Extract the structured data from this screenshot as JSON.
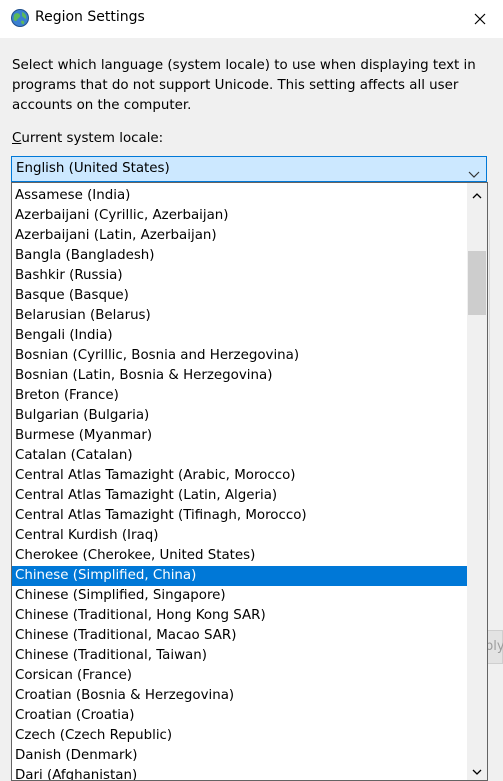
{
  "window": {
    "title": "Region Settings"
  },
  "dialog": {
    "description": "Select which language (system locale) to use when displaying text in programs that do not support Unicode. This setting affects all user accounts on the computer.",
    "locale_label_mnemonic": "C",
    "locale_label_rest": "urrent system locale:",
    "selected_locale": "English (United States)",
    "background_button_fragment": "ply"
  },
  "locales": [
    {
      "label": "Assamese (India)"
    },
    {
      "label": "Azerbaijani (Cyrillic, Azerbaijan)"
    },
    {
      "label": "Azerbaijani (Latin, Azerbaijan)"
    },
    {
      "label": "Bangla (Bangladesh)"
    },
    {
      "label": "Bashkir (Russia)"
    },
    {
      "label": "Basque (Basque)"
    },
    {
      "label": "Belarusian (Belarus)"
    },
    {
      "label": "Bengali (India)"
    },
    {
      "label": "Bosnian (Cyrillic, Bosnia and Herzegovina)"
    },
    {
      "label": "Bosnian (Latin, Bosnia & Herzegovina)"
    },
    {
      "label": "Breton (France)"
    },
    {
      "label": "Bulgarian (Bulgaria)"
    },
    {
      "label": "Burmese (Myanmar)"
    },
    {
      "label": "Catalan (Catalan)"
    },
    {
      "label": "Central Atlas Tamazight (Arabic, Morocco)"
    },
    {
      "label": "Central Atlas Tamazight (Latin, Algeria)"
    },
    {
      "label": "Central Atlas Tamazight (Tifinagh, Morocco)"
    },
    {
      "label": "Central Kurdish (Iraq)"
    },
    {
      "label": "Cherokee (Cherokee, United States)"
    },
    {
      "label": "Chinese (Simplified, China)",
      "selected": true
    },
    {
      "label": "Chinese (Simplified, Singapore)"
    },
    {
      "label": "Chinese (Traditional, Hong Kong SAR)"
    },
    {
      "label": "Chinese (Traditional, Macao SAR)"
    },
    {
      "label": "Chinese (Traditional, Taiwan)"
    },
    {
      "label": "Corsican (France)"
    },
    {
      "label": "Croatian (Bosnia & Herzegovina)"
    },
    {
      "label": "Croatian (Croatia)"
    },
    {
      "label": "Czech (Czech Republic)"
    },
    {
      "label": "Danish (Denmark)"
    },
    {
      "label": "Dari (Afghanistan)"
    }
  ],
  "icons": {
    "app": "globe-icon",
    "close": "close-icon",
    "combo_arrow": "chevron-down-icon",
    "scroll_up": "scroll-up-arrow-icon",
    "scroll_down": "scroll-down-arrow-icon"
  },
  "colors": {
    "accent": "#0078d7",
    "combo_background": "#cce8ff",
    "dialog_background": "#f0f0f0"
  }
}
